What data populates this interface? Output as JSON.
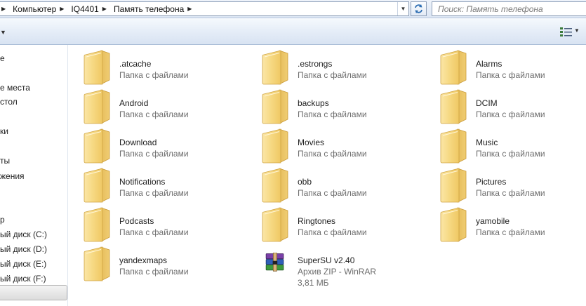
{
  "address_bar": {
    "crumbs": [
      "Компьютер",
      "IQ4401",
      "Память телефона"
    ]
  },
  "search": {
    "placeholder": "Поиск: Память телефона"
  },
  "navigation": {
    "items": [
      "е",
      "",
      "е места",
      "стол",
      "ки",
      "ты",
      "жения",
      "р",
      "ый диск (C:)",
      "ый диск (D:)",
      "ый диск (E:)",
      "ый диск (F:)"
    ]
  },
  "files": [
    {
      "name": ".atcache",
      "type": "Папка с файлами",
      "icon": "folder-icon"
    },
    {
      "name": ".estrongs",
      "type": "Папка с файлами",
      "icon": "folder-icon"
    },
    {
      "name": "Alarms",
      "type": "Папка с файлами",
      "icon": "folder-icon"
    },
    {
      "name": "Android",
      "type": "Папка с файлами",
      "icon": "folder-icon"
    },
    {
      "name": "backups",
      "type": "Папка с файлами",
      "icon": "folder-icon"
    },
    {
      "name": "DCIM",
      "type": "Папка с файлами",
      "icon": "folder-icon"
    },
    {
      "name": "Download",
      "type": "Папка с файлами",
      "icon": "folder-icon"
    },
    {
      "name": "Movies",
      "type": "Папка с файлами",
      "icon": "folder-icon"
    },
    {
      "name": "Music",
      "type": "Папка с файлами",
      "icon": "folder-icon"
    },
    {
      "name": "Notifications",
      "type": "Папка с файлами",
      "icon": "folder-icon"
    },
    {
      "name": "obb",
      "type": "Папка с файлами",
      "icon": "folder-icon"
    },
    {
      "name": "Pictures",
      "type": "Папка с файлами",
      "icon": "folder-icon"
    },
    {
      "name": "Podcasts",
      "type": "Папка с файлами",
      "icon": "folder-icon"
    },
    {
      "name": "Ringtones",
      "type": "Папка с файлами",
      "icon": "folder-icon"
    },
    {
      "name": "yamobile",
      "type": "Папка с файлами",
      "icon": "folder-icon"
    },
    {
      "name": "yandexmaps",
      "type": "Папка с файлами",
      "icon": "folder-icon"
    },
    {
      "name": "SuperSU v2.40",
      "type": "Архив ZIP - WinRAR",
      "size": "3,81 МБ",
      "icon": "winrar-archive-icon"
    }
  ],
  "colors": {
    "folder": "#f5d57a",
    "folder_dark": "#dcae45",
    "bar": "#dce6f4"
  }
}
